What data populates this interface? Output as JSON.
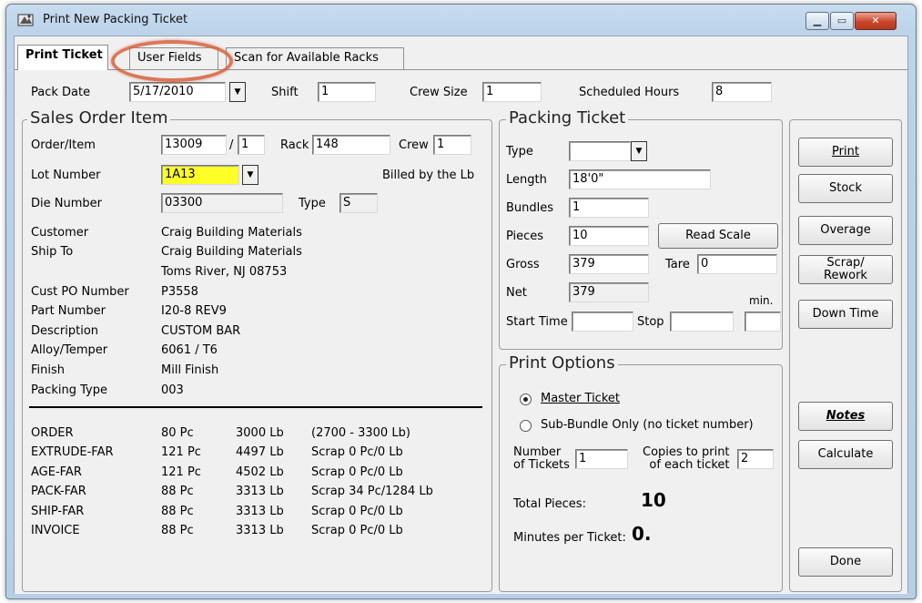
{
  "window": {
    "title": "Print New Packing Ticket",
    "min_icon": "minimize-icon",
    "max_icon": "maximize-icon",
    "close_icon": "close-icon"
  },
  "tabs": [
    {
      "label": "Print Ticket"
    },
    {
      "label": "User Fields"
    },
    {
      "label": "Scan for Available Racks"
    }
  ],
  "header": {
    "pack_date_label": "Pack Date",
    "pack_date_value": "5/17/2010",
    "shift_label": "Shift",
    "shift_value": "1",
    "crew_size_label": "Crew Size",
    "crew_size_value": "1",
    "scheduled_hours_label": "Scheduled Hours",
    "scheduled_hours_value": "8"
  },
  "sales_order": {
    "group_title": "Sales Order Item",
    "order_item_label": "Order/Item",
    "order_value": "13009",
    "slash": "/",
    "item_value": "1",
    "rack_label": "Rack",
    "rack_value": "148",
    "crew_label": "Crew",
    "crew_value": "1",
    "lot_label": "Lot Number",
    "lot_value": "1A13",
    "billed_text": "Billed by the Lb",
    "die_label": "Die Number",
    "die_value": "03300",
    "type_label": "Type",
    "type_value": "S",
    "details": [
      {
        "label": "Customer",
        "value": "Craig Building Materials"
      },
      {
        "label": "Ship To",
        "value": "Craig Building Materials"
      },
      {
        "label": "",
        "value": "Toms River, NJ 08753"
      },
      {
        "label": "Cust PO Number",
        "value": "P3558"
      },
      {
        "label": "Part Number",
        "value": "I20-8 REV9"
      },
      {
        "label": "Description",
        "value": "CUSTOM BAR"
      },
      {
        "label": "Alloy/Temper",
        "value": "6061 / T6"
      },
      {
        "label": "Finish",
        "value": "Mill Finish"
      },
      {
        "label": "Packing Type",
        "value": "003"
      }
    ],
    "stages": [
      {
        "name": "ORDER",
        "pcs": "80 Pc",
        "lbs": "3000 Lb",
        "note": "(2700 - 3300 Lb)"
      },
      {
        "name": "EXTRUDE-FAR",
        "pcs": "121 Pc",
        "lbs": "4497 Lb",
        "note": "Scrap 0 Pc/0 Lb"
      },
      {
        "name": "AGE-FAR",
        "pcs": "121 Pc",
        "lbs": "4502 Lb",
        "note": "Scrap 0 Pc/0 Lb"
      },
      {
        "name": "PACK-FAR",
        "pcs": "88 Pc",
        "lbs": "3313 Lb",
        "note": "Scrap 34 Pc/1284 Lb"
      },
      {
        "name": "SHIP-FAR",
        "pcs": "88 Pc",
        "lbs": "3313 Lb",
        "note": "Scrap 0 Pc/0 Lb"
      },
      {
        "name": "INVOICE",
        "pcs": "88 Pc",
        "lbs": "3313 Lb",
        "note": "Scrap 0 Pc/0 Lb"
      }
    ]
  },
  "packing_ticket": {
    "group_title": "Packing Ticket",
    "type_label": "Type",
    "type_value": "",
    "length_label": "Length",
    "length_value": "18'0\"",
    "bundles_label": "Bundles",
    "bundles_value": "1",
    "pieces_label": "Pieces",
    "pieces_value": "10",
    "read_scale_label": "Read Scale",
    "gross_label": "Gross",
    "gross_value": "379",
    "tare_label": "Tare",
    "tare_value": "0",
    "net_label": "Net",
    "net_value": "379",
    "min_label": "min.",
    "start_label": "Start Time",
    "start_value": "",
    "stop_label": "Stop",
    "stop_value": "",
    "min_value": ""
  },
  "print_options": {
    "group_title": "Print Options",
    "master_label": "Master Ticket",
    "sub_bundle_label": "Sub-Bundle Only (no ticket number)",
    "num_tickets_label_1": "Number",
    "num_tickets_label_2": "of Tickets",
    "num_tickets_value": "1",
    "copies_label_1": "Copies to print",
    "copies_label_2": "of each ticket",
    "copies_value": "2",
    "total_pieces_label": "Total Pieces:",
    "total_pieces_value": "10",
    "minutes_label": "Minutes per Ticket:",
    "minutes_value": "0."
  },
  "buttons": {
    "print": "Print",
    "stock": "Stock",
    "overage": "Overage",
    "scrap_1": "Scrap/",
    "scrap_2": "Rework",
    "down_time": "Down Time",
    "notes": "Notes",
    "calculate": "Calculate",
    "done": "Done"
  }
}
